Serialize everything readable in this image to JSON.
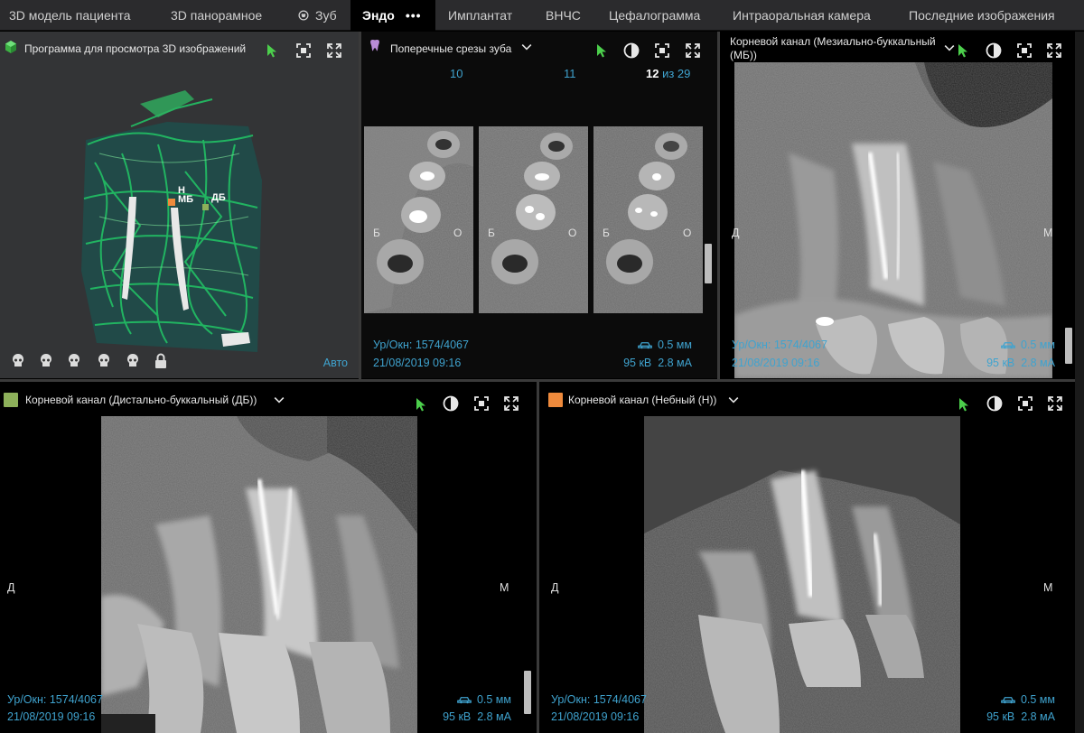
{
  "tabs": [
    {
      "label": "3D модель пациента"
    },
    {
      "label": "3D панорамное"
    },
    {
      "label": "Зуб"
    },
    {
      "label": "Эндо",
      "dots": "•••"
    },
    {
      "label": "Имплантат"
    },
    {
      "label": "ВНЧС"
    },
    {
      "label": "Цефалограмма"
    },
    {
      "label": "Интраоральная камера"
    },
    {
      "label": "Последние изображения"
    }
  ],
  "viewer3d": {
    "title": "Программа для просмотра 3D изображений",
    "mode": "Авто",
    "markers": {
      "n": "Н",
      "mb": "МБ",
      "db": "ДБ"
    },
    "colors": {
      "cube": "#3cb043",
      "mesh": "#22c064",
      "mesh_bg": "#1f4d4a"
    }
  },
  "slices": {
    "title": "Поперечные срезы зуба",
    "nums": [
      "10",
      "11",
      "12"
    ],
    "of": "из 29",
    "side_b": "Б",
    "side_o": "О",
    "info1": "Ур/Окн: 1574/4067",
    "info2": "21/08/2019 09:16",
    "info3": "0.5 мм",
    "info4": "95 кВ  2.8 мА"
  },
  "mb": {
    "title1": "Корневой канал (Мезиально-буккальный",
    "title2": "(МБ))",
    "left": "Д",
    "right": "М",
    "info1": "Ур/Окн: 1574/4067",
    "info2": "21/08/2019 09:16",
    "info3": "0.5 мм",
    "info4": "95 кВ  2.8 мА"
  },
  "db": {
    "title": "Корневой канал (Дистально-буккальный (ДБ))",
    "color": "#8db05a",
    "left": "Д",
    "right": "М",
    "info1": "Ур/Окн: 1574/4067",
    "info2": "21/08/2019 09:16",
    "info3": "0.5 мм",
    "info4": "95 кВ  2.8 мА"
  },
  "n": {
    "title": "Корневой канал (Небный (Н))",
    "color": "#ee8a3c",
    "left": "Д",
    "right": "М",
    "info1": "Ур/Окн: 1574/4067",
    "info2": "21/08/2019 09:16",
    "info3": "0.5 мм",
    "info4": "95 кВ  2.8 мА"
  },
  "colors": {
    "accent": "#3fa3cf",
    "pointer": "#4ccf4c",
    "topbar": "#2b2b2d"
  }
}
